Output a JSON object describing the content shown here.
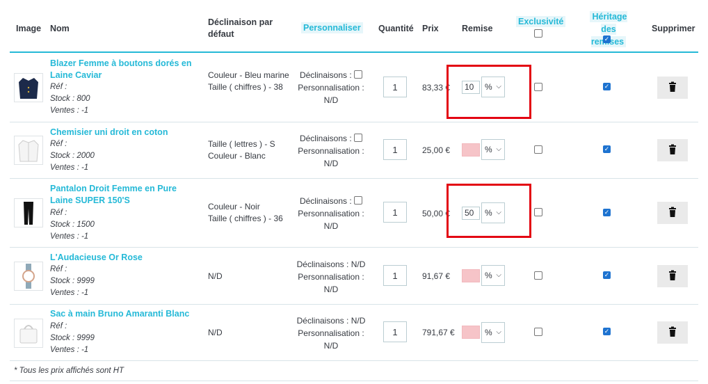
{
  "headers": {
    "image": "Image",
    "name": "Nom",
    "declinaison": "Déclinaison par défaut",
    "personnaliser": "Personnaliser",
    "quantite": "Quantité",
    "prix": "Prix",
    "remise": "Remise",
    "exclusivite": "Exclusivité",
    "heritage": "Héritage des remises",
    "supprimer": "Supprimer"
  },
  "rows": [
    {
      "name": "Blazer Femme à boutons dorés en Laine Caviar",
      "ref": "Réf :",
      "stock": "Stock : 800",
      "ventes": "Ventes : -1",
      "declinaison": [
        "Couleur - Bleu marine",
        "Taille ( chiffres ) - 38"
      ],
      "cust_decl": "Déclinaisons :",
      "cust_decl_value": "",
      "cust_perso": "Personnalisation :",
      "cust_perso_value": "N/D",
      "quantity": "1",
      "price": "83,33 €",
      "discount": "10",
      "discount_unit": "%",
      "exclusive": false,
      "inherit": true
    },
    {
      "name": "Chemisier uni droit en coton",
      "ref": "Réf :",
      "stock": "Stock : 2000",
      "ventes": "Ventes : -1",
      "declinaison": [
        "Taille ( lettres ) - S",
        "Couleur - Blanc"
      ],
      "cust_decl": "Déclinaisons :",
      "cust_decl_value": "",
      "cust_perso": "Personnalisation :",
      "cust_perso_value": "N/D",
      "quantity": "1",
      "price": "25,00 €",
      "discount": "",
      "discount_unit": "%",
      "exclusive": false,
      "inherit": true
    },
    {
      "name": "Pantalon Droit Femme en Pure Laine SUPER 150'S",
      "ref": "Réf :",
      "stock": "Stock : 1500",
      "ventes": "Ventes : -1",
      "declinaison": [
        "Couleur - Noir",
        "Taille ( chiffres ) - 36"
      ],
      "cust_decl": "Déclinaisons :",
      "cust_decl_value": "",
      "cust_perso": "Personnalisation :",
      "cust_perso_value": "N/D",
      "quantity": "1",
      "price": "50,00 €",
      "discount": "50",
      "discount_unit": "%",
      "exclusive": false,
      "inherit": true
    },
    {
      "name": "L'Audacieuse Or Rose",
      "ref": "Réf :",
      "stock": "Stock : 9999",
      "ventes": "Ventes : -1",
      "declinaison": [
        "N/D"
      ],
      "cust_decl": "Déclinaisons :",
      "cust_decl_value": "N/D",
      "cust_perso": "Personnalisation :",
      "cust_perso_value": "N/D",
      "quantity": "1",
      "price": "91,67 €",
      "discount": "",
      "discount_unit": "%",
      "exclusive": false,
      "inherit": true
    },
    {
      "name": "Sac à main Bruno Amaranti Blanc",
      "ref": "Réf :",
      "stock": "Stock : 9999",
      "ventes": "Ventes : -1",
      "declinaison": [
        "N/D"
      ],
      "cust_decl": "Déclinaisons :",
      "cust_decl_value": "N/D",
      "cust_perso": "Personnalisation :",
      "cust_perso_value": "N/D",
      "quantity": "1",
      "price": "791,67 €",
      "discount": "",
      "discount_unit": "%",
      "exclusive": false,
      "inherit": true
    }
  ],
  "footnote": "* Tous les prix affichés sont HT",
  "colors": {
    "accent": "#25b9d7",
    "highlight": "#e30613",
    "empty_field": "#f6c4c8",
    "checkbox": "#1e73d0"
  },
  "icons": {
    "delete": "trash-icon",
    "select": "chevron-down-icon"
  }
}
